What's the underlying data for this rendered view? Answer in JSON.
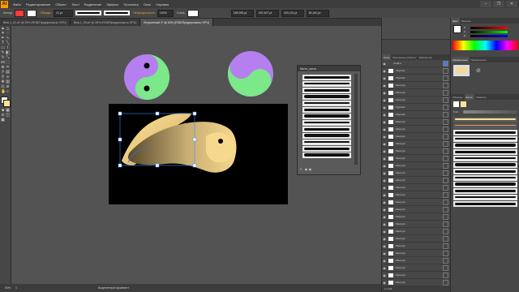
{
  "app": {
    "logo": "Ai"
  },
  "menu": [
    "Файл",
    "Редактирование",
    "Объект",
    "Текст",
    "Выделение",
    "Эффект",
    "Просмотр",
    "Окно",
    "Справка"
  ],
  "window_buttons": [
    "–",
    "❐",
    "✕"
  ],
  "controlbar": {
    "mode": "Контур",
    "stroke_label": "Обводка",
    "stroke_value": "21 pt",
    "opacity_label": "Непрозрачность",
    "opacity_value": "100%",
    "style_label": "Стиль",
    "x_value": "185,953 pt",
    "y_value": "187,607 pt",
    "w_value": "150,124 pt",
    "h_value": "80,440 pt"
  },
  "tabs": [
    {
      "label": "Blob-1_01.ai* @ 25% (RGB/Предпросмотр GPU)",
      "active": false
    },
    {
      "label": "Blob-1_05.ai* @ 25% (RGB/Предпросмотр GPU)",
      "active": false
    },
    {
      "label": "Встроенный 2* @ 50% (RGB/Предпросмотр GPU)",
      "active": true
    }
  ],
  "statusbar": {
    "zoom": "50%",
    "page": "1",
    "tool": "Выделенный фрагмент"
  },
  "brushes_panel": {
    "title": "Кисти_кисть"
  },
  "layers_panel": {
    "tabs": [
      "Слои",
      "Монтажные области",
      "Библиотеки"
    ],
    "layer_name": "Слой 1",
    "rows": [
      "<Группа>",
      "<Группа>",
      "<Контур>",
      "<Контур>",
      "<Контур>",
      "<Группа>",
      "<Группа>",
      "<Контур>",
      "<Контур>",
      "<Контур>",
      "<Контур>",
      "<Контур>",
      "<Контур>",
      "<Контур>",
      "<Контур>",
      "<Контур>",
      "<Контур>",
      "<Контур>",
      "<Контур>",
      "<Контур>",
      "<Контур>",
      "<Контур>",
      "<Контур>",
      "<Контур>",
      "<Контур>",
      "<Контур>",
      "<Контур>",
      "<Контур>",
      "<Контур>",
      "<Контур>"
    ],
    "footer": "1 слой"
  },
  "color_panel": {
    "tabs": [
      "Цвет",
      "Палитра"
    ],
    "channels": [
      "R",
      "G",
      "B"
    ]
  },
  "appearance_panel": {
    "tabs": [
      "Оформление",
      "Прозрачность"
    ]
  },
  "brushes_dock": {
    "tabs": [
      "Образцы",
      "Кисти",
      "Символы"
    ],
    "size_value": "5,00"
  }
}
